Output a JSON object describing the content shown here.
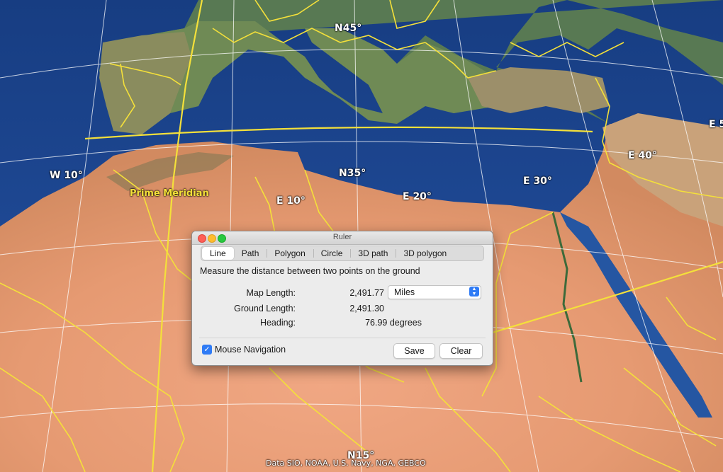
{
  "map": {
    "labels": {
      "n45": "N45°",
      "w10": "W 10°",
      "prime_meridian": "Prime Meridian",
      "e10": "E 10°",
      "n35": "N35°",
      "e20": "E 20°",
      "e30": "E 30°",
      "e40": "E 40°",
      "e5x": "E 5",
      "n15": "N15°"
    },
    "attribution": "Data SIO, NOAA, U.S. Navy, NGA, GEBCO",
    "colors": {
      "ocean": "#1f4d9a",
      "land": "#e69a72",
      "borders": "#f4e03a",
      "grid": "#ffffff"
    }
  },
  "ruler": {
    "title": "Ruler",
    "tabs": [
      "Line",
      "Path",
      "Polygon",
      "Circle",
      "3D path",
      "3D polygon"
    ],
    "active_tab": "Line",
    "description": "Measure the distance between two points on the ground",
    "map_length_label": "Map Length:",
    "map_length_value": "2,491.77",
    "units_selected": "Miles",
    "ground_length_label": "Ground Length:",
    "ground_length_value": "2,491.30",
    "heading_label": "Heading:",
    "heading_value": "76.99 degrees",
    "mouse_navigation_label": "Mouse Navigation",
    "mouse_navigation_checked": true,
    "save_label": "Save",
    "clear_label": "Clear"
  }
}
